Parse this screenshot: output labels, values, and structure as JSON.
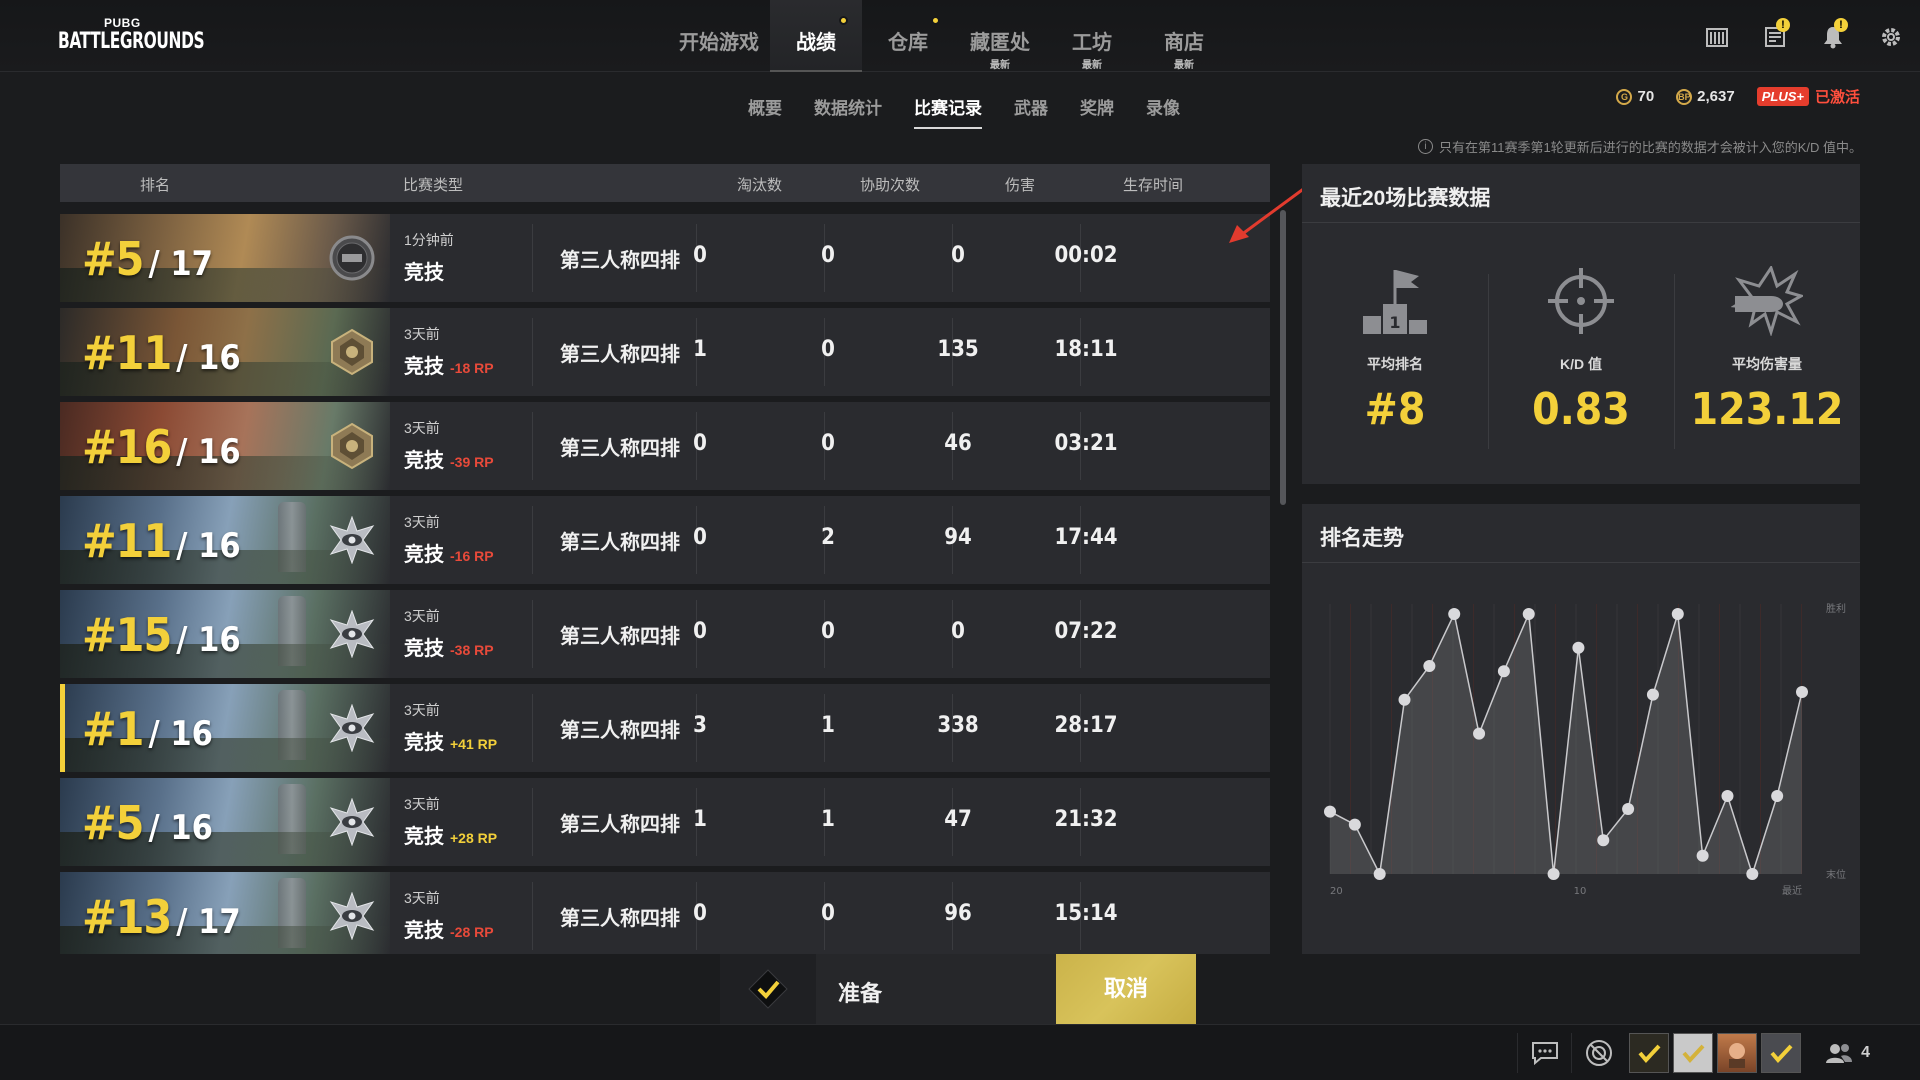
{
  "brand": {
    "small": "PUBG",
    "big": "BATTLEGROUNDS"
  },
  "main_nav": [
    {
      "label": "开始游戏",
      "active": false,
      "dot": false,
      "tag": ""
    },
    {
      "label": "战绩",
      "active": true,
      "dot": true,
      "tag": ""
    },
    {
      "label": "仓库",
      "active": false,
      "dot": true,
      "tag": ""
    },
    {
      "label": "藏匿处",
      "active": false,
      "dot": false,
      "tag": "最新"
    },
    {
      "label": "工坊",
      "active": false,
      "dot": false,
      "tag": "最新"
    },
    {
      "label": "商店",
      "active": false,
      "dot": false,
      "tag": "最新"
    }
  ],
  "top_icons": [
    "calendar-icon",
    "news-icon",
    "bell-icon",
    "settings-gear-icon"
  ],
  "currency": {
    "g_coin": "70",
    "bp": "2,637",
    "plus_label": "PLUS+",
    "plus_status": "已激活",
    "g_symbol": "G",
    "bp_symbol": "BP"
  },
  "sub_nav": [
    {
      "label": "概要",
      "active": false,
      "dot": true
    },
    {
      "label": "数据统计",
      "active": false,
      "dot": false
    },
    {
      "label": "比赛记录",
      "active": true,
      "dot": false
    },
    {
      "label": "武器",
      "active": false,
      "dot": false
    },
    {
      "label": "奖牌",
      "active": false,
      "dot": false
    },
    {
      "label": "录像",
      "active": false,
      "dot": false
    }
  ],
  "notice": {
    "icon": "i",
    "text": "只有在第11赛季第1轮更新后进行的比赛的数据才会被计入您的K/D 值中。"
  },
  "table": {
    "headers": {
      "rank": "排名",
      "type": "比赛类型",
      "kills": "淘汰数",
      "assists": "协助次数",
      "damage": "伤害",
      "survival": "生存时间"
    },
    "rows": [
      {
        "map": "miramar",
        "badge": "pubg",
        "rank": "#5",
        "total": "/ 17",
        "when": "1分钟前",
        "mode": "竞技",
        "rp": "",
        "rp_sign": "",
        "type": "第三人称四排",
        "kills": "0",
        "assists": "0",
        "damage": "0",
        "time": "00:02"
      },
      {
        "map": "sanhok",
        "badge": "crest",
        "rank": "#11",
        "total": "/ 16",
        "when": "3天前",
        "mode": "竞技",
        "rp": "-18 RP",
        "rp_sign": "neg",
        "type": "第三人称四排",
        "kills": "1",
        "assists": "0",
        "damage": "135",
        "time": "18:11"
      },
      {
        "map": "taego",
        "badge": "crest",
        "rank": "#16",
        "total": "/ 16",
        "when": "3天前",
        "mode": "竞技",
        "rp": "-39 RP",
        "rp_sign": "neg",
        "type": "第三人称四排",
        "kills": "0",
        "assists": "0",
        "damage": "46",
        "time": "03:21"
      },
      {
        "map": "erangel",
        "badge": "eye",
        "rank": "#11",
        "total": "/ 16",
        "when": "3天前",
        "mode": "竞技",
        "rp": "-16 RP",
        "rp_sign": "neg",
        "type": "第三人称四排",
        "kills": "0",
        "assists": "2",
        "damage": "94",
        "time": "17:44"
      },
      {
        "map": "erangel",
        "badge": "eye",
        "rank": "#15",
        "total": "/ 16",
        "when": "3天前",
        "mode": "竞技",
        "rp": "-38 RP",
        "rp_sign": "neg",
        "type": "第三人称四排",
        "kills": "0",
        "assists": "0",
        "damage": "0",
        "time": "07:22"
      },
      {
        "map": "erangel",
        "badge": "eye",
        "rank": "#1",
        "total": "/ 16",
        "when": "3天前",
        "mode": "竞技",
        "rp": "+41 RP",
        "rp_sign": "pos",
        "type": "第三人称四排",
        "kills": "3",
        "assists": "1",
        "damage": "338",
        "time": "28:17",
        "highlight": true
      },
      {
        "map": "erangel",
        "badge": "eye",
        "rank": "#5",
        "total": "/ 16",
        "when": "3天前",
        "mode": "竞技",
        "rp": "+28 RP",
        "rp_sign": "pos",
        "type": "第三人称四排",
        "kills": "1",
        "assists": "1",
        "damage": "47",
        "time": "21:32"
      },
      {
        "map": "erangel",
        "badge": "eye",
        "rank": "#13",
        "total": "/ 17",
        "when": "3天前",
        "mode": "竞技",
        "rp": "-28 RP",
        "rp_sign": "neg",
        "type": "第三人称四排",
        "kills": "0",
        "assists": "0",
        "damage": "96",
        "time": "15:14"
      }
    ]
  },
  "recent": {
    "title": "最近20场比赛数据",
    "stats": [
      {
        "icon": "podium-icon",
        "label": "平均排名",
        "value": "#8"
      },
      {
        "icon": "crosshair-icon",
        "label": "K/D 值",
        "value": "0.83"
      },
      {
        "icon": "bullet-impact-icon",
        "label": "平均伤害量",
        "value": "123.12"
      }
    ]
  },
  "trend": {
    "title": "排名走势",
    "top_label": "胜利",
    "bottom_label": "末位",
    "x_labels": [
      "20",
      "10",
      "最近"
    ]
  },
  "chart_data": {
    "type": "line",
    "title": "排名走势",
    "xlabel": "",
    "ylabel": "",
    "x_tick_labels": [
      "20",
      "10",
      "最近"
    ],
    "y_tick_labels": [
      "胜利",
      "末位"
    ],
    "y_range_labels": {
      "top": "胜利",
      "bottom": "末位"
    },
    "grid": true,
    "series": [
      {
        "values": [
          0.24,
          0.19,
          0.0,
          0.67,
          0.8,
          1.0,
          0.54,
          0.78,
          1.0,
          0.0,
          0.87,
          0.13,
          0.25,
          0.69,
          1.0,
          0.07,
          0.3,
          0.0,
          0.3,
          0.7
        ]
      }
    ]
  },
  "ready_bar": {
    "ready_label": "准备",
    "cancel_label": "取消"
  },
  "bottom_bar": {
    "icons": [
      "chat-icon",
      "radar-icon"
    ],
    "friends_count": "4"
  },
  "colors": {
    "accent_yellow": "#f3d03a",
    "negative_red": "#e84a3a",
    "plus_red": "#e53d2d"
  }
}
